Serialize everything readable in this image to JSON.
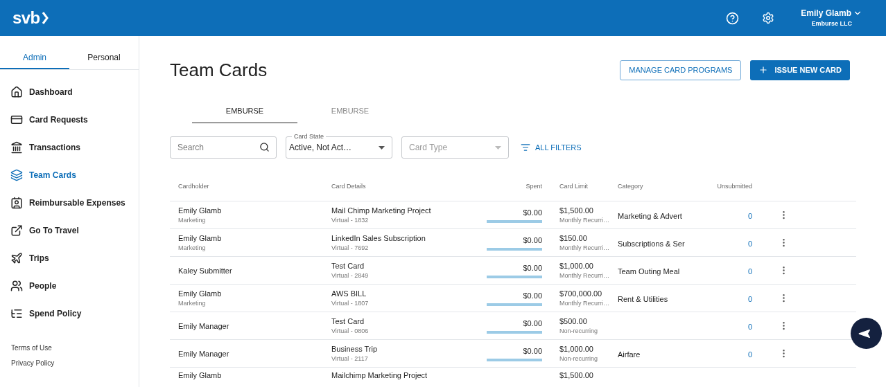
{
  "header": {
    "logo": "svb",
    "user": {
      "name": "Emily Glamb",
      "company": "Emburse LLC"
    }
  },
  "sidebar": {
    "tabs": [
      {
        "label": "Admin",
        "selected": true
      },
      {
        "label": "Personal",
        "selected": false
      }
    ],
    "items": [
      {
        "label": "Dashboard",
        "kind": "home",
        "selected": false
      },
      {
        "label": "Card Requests",
        "kind": "card-plus",
        "selected": false
      },
      {
        "label": "Transactions",
        "kind": "bank",
        "selected": false
      },
      {
        "label": "Team Cards",
        "kind": "cards",
        "selected": true
      },
      {
        "label": "Reimbursable Expenses",
        "kind": "person-receipt",
        "selected": false
      },
      {
        "label": "Go To Travel",
        "kind": "external",
        "selected": false
      },
      {
        "label": "Trips",
        "kind": "plane",
        "selected": false
      },
      {
        "label": "People",
        "kind": "people",
        "selected": false
      },
      {
        "label": "Spend Policy",
        "kind": "list",
        "selected": false
      }
    ],
    "footer_links": [
      "Terms of Use",
      "Privacy Policy"
    ]
  },
  "page": {
    "title": "Team Cards",
    "buttons": [
      {
        "label": "MANAGE CARD PROGRAMS",
        "kind": "outline"
      },
      {
        "label": "ISSUE NEW CARD",
        "kind": "primary"
      }
    ],
    "tabs": [
      {
        "label": "EMBURSE",
        "selected": true
      },
      {
        "label": "EMBURSE",
        "selected": false
      }
    ],
    "filters": {
      "search": {
        "placeholder": "Search"
      },
      "card_state": {
        "label": "Card State",
        "value": "Active, Not Act…"
      },
      "card_type": {
        "placeholder": "Card Type"
      },
      "all_filters": "ALL FILTERS"
    }
  },
  "table": {
    "columns": [
      "Cardholder",
      "Card Details",
      "Spent",
      "Card Limit",
      "Category",
      "Unsubmitted"
    ],
    "rows": [
      {
        "name": "Emily Glamb",
        "department": "Marketing",
        "card": "Mail Chimp Marketing Project",
        "card_number": "Virtual - 1832",
        "spent": "$0.00",
        "limit": "$1,500.00",
        "period": "Monthly Recurri…",
        "category": "Marketing & Advert",
        "unsubmitted": "0"
      },
      {
        "name": "Emily Glamb",
        "department": "Marketing",
        "card": "LinkedIn Sales Subscription",
        "card_number": "Virtual - 7692",
        "spent": "$0.00",
        "limit": "$150.00",
        "period": "Monthly Recurri…",
        "category": "Subscriptions & Ser",
        "unsubmitted": "0"
      },
      {
        "name": "Kaley Submitter",
        "card": "Test Card",
        "card_number": "Virtual - 2849",
        "spent": "$0.00",
        "limit": "$1,000.00",
        "period": "Monthly Recurri…",
        "category": "Team Outing Meal",
        "unsubmitted": "0"
      },
      {
        "name": "Emily Glamb",
        "department": "Marketing",
        "card": "AWS BILL",
        "card_number": "Virtual - 1807",
        "spent": "$0.00",
        "limit": "$700,000.00",
        "period": "Monthly Recurri…",
        "category": "Rent & Utilities",
        "unsubmitted": "0"
      },
      {
        "name": "Emily Manager",
        "card": "Test Card",
        "card_number": "Virtual - 0806",
        "spent": "$0.00",
        "limit": "$500.00",
        "period": "Non-recurring",
        "unsubmitted": "0"
      },
      {
        "name": "Emily Manager",
        "card": "Business Trip",
        "card_number": "Virtual - 2117",
        "spent": "$0.00",
        "limit": "$1,000.00",
        "period": "Non-recurring",
        "category": "Airfare",
        "unsubmitted": "0"
      },
      {
        "name": "Emily Glamb",
        "card": "Mailchimp Marketing Project",
        "limit": "$1,500.00"
      }
    ]
  }
}
